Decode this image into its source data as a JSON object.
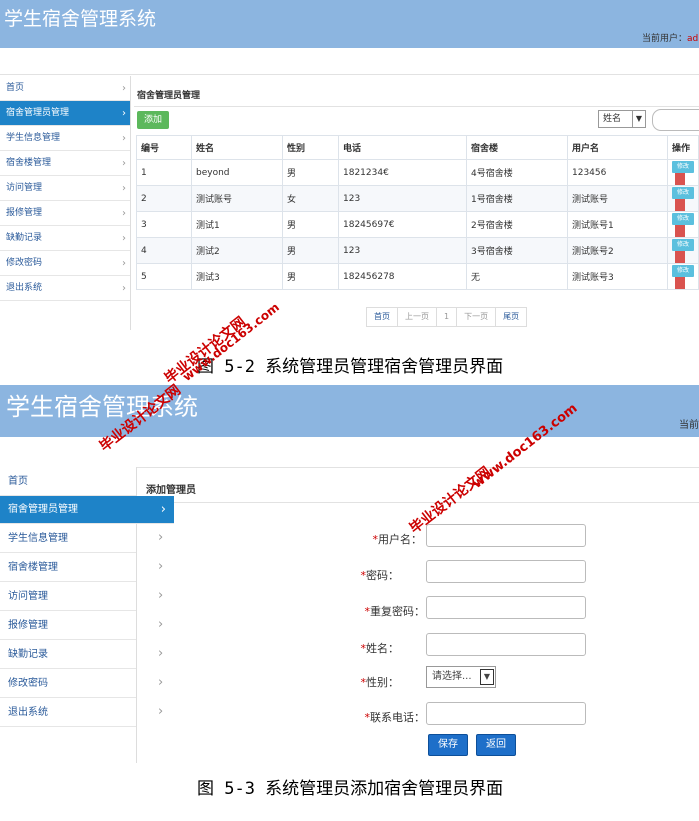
{
  "shot1": {
    "app_title": "学生宿舍管理系统",
    "current_user_label": "当前用户：",
    "current_user_value": "ad",
    "sidebar": [
      "首页",
      "宿舍管理员管理",
      "学生信息管理",
      "宿舍楼管理",
      "访问管理",
      "报修管理",
      "缺勤记录",
      "修改密码",
      "退出系统"
    ],
    "active_index": 1,
    "panel_title": "宿舍管理员管理",
    "add_label": "添加",
    "filter_select": "姓名",
    "columns": [
      "编号",
      "姓名",
      "性别",
      "电话",
      "宿舍楼",
      "用户名",
      "操作"
    ],
    "rows": [
      [
        "1",
        "beyond",
        "男",
        "1821234€",
        "4号宿舍楼",
        "123456"
      ],
      [
        "2",
        "测试账号",
        "女",
        "123",
        "1号宿舍楼",
        "测试账号"
      ],
      [
        "3",
        "测试1",
        "男",
        "18245697€",
        "2号宿舍楼",
        "测试账号1"
      ],
      [
        "4",
        "测试2",
        "男",
        "123",
        "3号宿舍楼",
        "测试账号2"
      ],
      [
        "5",
        "测试3",
        "男",
        "182456278",
        "无",
        "测试账号3"
      ]
    ],
    "edit_label": "修改",
    "pager": [
      "首页",
      "上一页",
      "1",
      "下一页",
      "尾页"
    ],
    "caption": "图 5-2 系统管理员管理宿舍管理员界面"
  },
  "shot2": {
    "app_title": "学生宿舍管理系统",
    "current_user_label": "当前",
    "sidebar": [
      "首页",
      "宿舍管理员管理",
      "学生信息管理",
      "宿舍楼管理",
      "访问管理",
      "报修管理",
      "缺勤记录",
      "修改密码",
      "退出系统"
    ],
    "active_index": 1,
    "panel_title": "添加管理员",
    "fields": [
      {
        "label": "用户名："
      },
      {
        "label": "密码："
      },
      {
        "label": "重复密码："
      },
      {
        "label": "姓名："
      },
      {
        "label": "性别：",
        "select": "请选择..."
      },
      {
        "label": "联系电话："
      }
    ],
    "required_mark": "*",
    "save_label": "保存",
    "back_label": "返回",
    "caption": "图 5-3 系统管理员添加宿舍管理员界面"
  },
  "watermarks": [
    "毕业设计论文网",
    "www.doc163.com"
  ]
}
